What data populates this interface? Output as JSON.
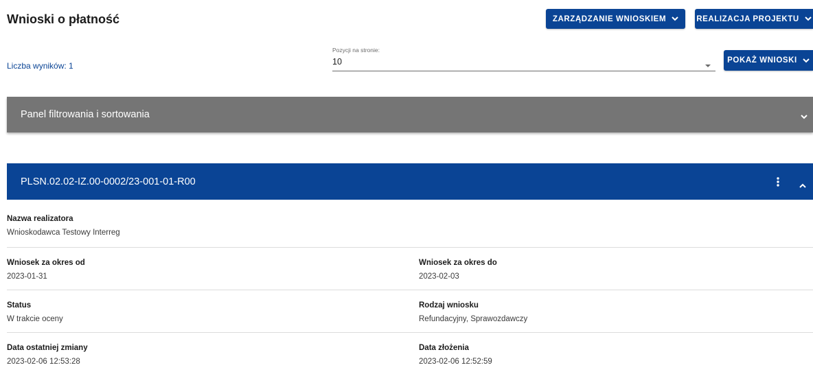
{
  "header": {
    "title": "Wnioski o płatność",
    "btn_manage": "ZARZĄDZANIE WNIOSKIEM",
    "btn_realization": "REALIZACJA PROJEKTU"
  },
  "toolbar": {
    "results_label": "Liczba wyników: 1",
    "per_page_label": "Pozycji na stronie:",
    "per_page_value": "10",
    "show_button": "POKAŻ WNIOSKI"
  },
  "filter_panel": {
    "label": "Panel filtrowania i sortowania"
  },
  "card": {
    "title": "PLSN.02.02-IZ.00-0002/23-001-01-R00",
    "fields": {
      "realizator_label": "Nazwa realizatora",
      "realizator_value": "Wnioskodawca Testowy Interreg",
      "from_label": "Wniosek za okres od",
      "from_value": "2023-01-31",
      "to_label": "Wniosek za okres do",
      "to_value": "2023-02-03",
      "status_label": "Status",
      "status_value": "W trakcie oceny",
      "type_label": "Rodzaj wniosku",
      "type_value": "Refundacyjny, Sprawozdawczy",
      "changed_label": "Data ostatniej zmiany",
      "changed_value": "2023-02-06 12:53:28",
      "submitted_label": "Data złożenia",
      "submitted_value": "2023-02-06 12:52:59"
    }
  },
  "colors": {
    "primary": "#0a4495",
    "filter_bg": "#757575",
    "link": "#0a4495"
  },
  "icons": [
    "chevron-down-icon",
    "chevron-up-icon",
    "more-vert-icon",
    "dropdown-arrow-icon"
  ]
}
